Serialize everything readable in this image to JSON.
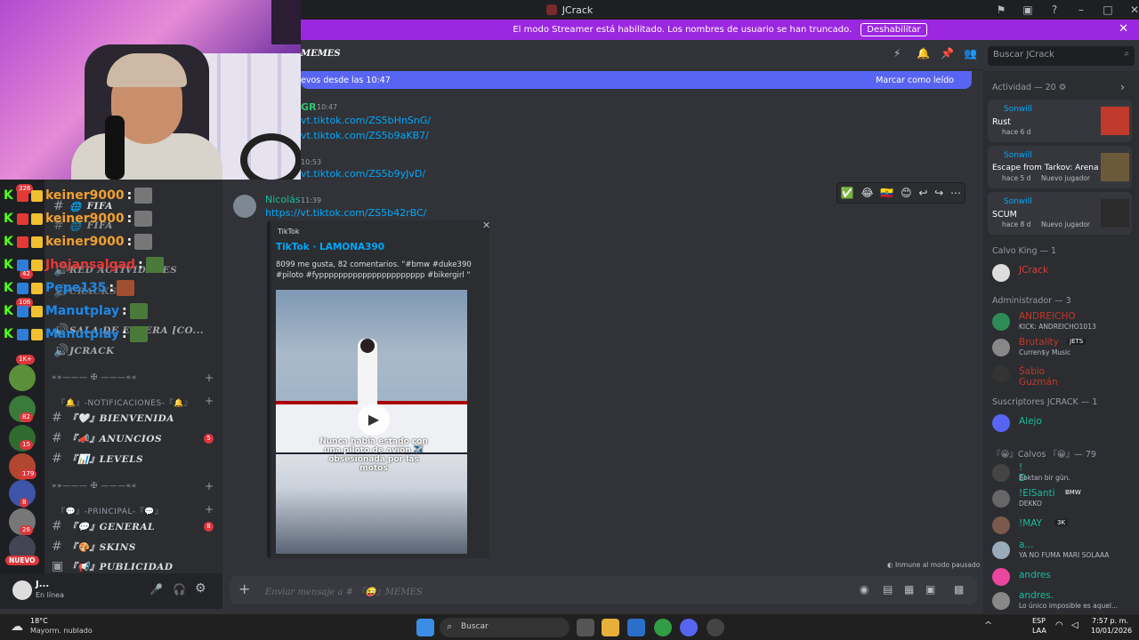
{
  "window": {
    "title": "JCrack",
    "brand_color": "#9c27e0"
  },
  "banner": {
    "text": "El modo Streamer está habilitado. Los nombres de usuario se han truncado.",
    "button": "Deshabilitar"
  },
  "channel_header": {
    "name": "MEMES"
  },
  "new_messages": {
    "text": "evos desde las 10:47",
    "mark_read": "Marcar como leído"
  },
  "messages": [
    {
      "author": "GR",
      "time": "10:47",
      "lines": [
        "vt.tiktok.com/ZS5bHnSnG/",
        "vt.tiktok.com/ZS5b9aKB7/"
      ]
    },
    {
      "time": "10:53",
      "lines": [
        "vt.tiktok.com/ZS5b9yJvD/"
      ]
    },
    {
      "author": "Nicolás",
      "time": "11:39",
      "link": "https://vt.tiktok.com/ZS5b42rBC/"
    }
  ],
  "embed": {
    "provider": "TikTok",
    "title": "TikTok · LAMONA390",
    "description": "8099 me gusta, 82 comentarios. \"#bmw #duke390 #piloto #fypppppppppppppppppppppp #bikergirl \"",
    "caption": "Nunca había estado con una piloto de avión ✈️ obsesionada por las motos"
  },
  "hover_icons": [
    "✅",
    "😂",
    "🇪🇨",
    "😊",
    "↩",
    "↪",
    "⋯"
  ],
  "footer_note": "Inmune al modo pausado",
  "input": {
    "placeholder": "Enviar mensaje a # 『😜』MEMES"
  },
  "search": {
    "placeholder": "Buscar JCrack"
  },
  "members": {
    "activity_header": "Actividad — 20 ⚙",
    "activities": [
      {
        "name": "Sonwill",
        "game": "Rust",
        "time": "hace 6 d",
        "extra": ""
      },
      {
        "name": "Sonwill",
        "game": "Escape from Tarkov: Arena",
        "time": "hace 5 d",
        "extra": "Nuevo jugador"
      },
      {
        "name": "Sonwill",
        "game": "SCUM",
        "time": "hace 8 d",
        "extra": "Nuevo jugador"
      }
    ],
    "groups": [
      {
        "header": "Calvo King — 1",
        "rows": [
          {
            "name": "JCrack",
            "sub": "",
            "color": "#e03e3e"
          }
        ]
      },
      {
        "header": "Administrador — 3",
        "rows": [
          {
            "name": "ANDREICHO",
            "sub": "KICK: ANDREICHO1013",
            "color": "#c0392b"
          },
          {
            "name": "Brutality",
            "sub": "Curren$y Music",
            "color": "#c0392b",
            "tag": "JETS"
          },
          {
            "name": "Šabio Guzmán",
            "sub": "",
            "color": "#c0392b"
          }
        ]
      },
      {
        "header": "Suscriptores JCRACK — 1",
        "rows": [
          {
            "name": "Alejo",
            "sub": "",
            "color": "#1abc9c"
          }
        ]
      },
      {
        "header": "『😀』Calvos 『😀』— 79",
        "rows": [
          {
            "name": "! D",
            "sub": "Boktan bir gün.",
            "color": "#1abc9c"
          },
          {
            "name": "!ElSanti",
            "sub": "DEKKO",
            "color": "#1abc9c",
            "tag": "BMW"
          },
          {
            "name": "!MAY",
            "sub": "",
            "color": "#1abc9c",
            "tag": "3K"
          },
          {
            "name": "a...",
            "sub": "YA NO FUMA MARI SOLAAA",
            "color": "#1abc9c"
          },
          {
            "name": "andres",
            "sub": "",
            "color": "#1abc9c"
          },
          {
            "name": "andres.",
            "sub": "Lo único imposible es aquel...",
            "color": "#1abc9c"
          }
        ]
      }
    ]
  },
  "chat_overlay": [
    {
      "user": "keiner9000",
      "color": "#f0a030"
    },
    {
      "user": "keiner9000",
      "color": "#f0a030"
    },
    {
      "user": "keiner9000",
      "color": "#f0a030"
    },
    {
      "user": "Jhojansalgad",
      "color": "#e53935"
    },
    {
      "user": "Pepe135",
      "color": "#1e88e5"
    },
    {
      "user": "Manutplay",
      "color": "#1e88e5"
    },
    {
      "user": "Manutplay",
      "color": "#1e88e5"
    }
  ],
  "channels": {
    "items": [
      {
        "label": "FIFA",
        "icon": "🌐"
      },
      {
        "label": "FIFA",
        "icon": "🌐"
      },
      {
        "label": "RED ACTIVIDADES",
        "icon": "🔊"
      },
      {
        "label": "CRACKS",
        "icon": "🔊"
      },
      {
        "label": "JCRACK",
        "icon": "🔊"
      }
    ],
    "cat_streams": "『🔔』-NOTIFICACIONES-『🔔』",
    "notif": [
      {
        "label": "『🤍』BIENVENIDA",
        "badge": ""
      },
      {
        "label": "『📣』ANUNCIOS",
        "badge": "5"
      },
      {
        "label": "『📊』LEVELS",
        "badge": ""
      }
    ],
    "cat_main": "『💬』-PRINCIPAL-『💬』",
    "main": [
      {
        "label": "『💬』GENERAL",
        "badge": "8"
      },
      {
        "label": "『🎨』SKINS",
        "badge": ""
      },
      {
        "label": "『📢』PUBLICIDAD",
        "badge": ""
      }
    ],
    "sala": "SALA DE ESPERA [CO..."
  },
  "user_panel": {
    "name": "J...",
    "status": "En línea"
  },
  "server_badges": [
    "326",
    "42",
    "106",
    "1K+",
    "82",
    "15",
    "179",
    "8",
    "26"
  ],
  "nuevo": "NUEVO",
  "taskbar": {
    "weather_temp": "18°C",
    "weather_desc": "Mayorm. nublado",
    "search": "Buscar",
    "lang1": "ESP",
    "lang2": "LAA",
    "time": "7:57 p. m.",
    "date": "10/01/2026"
  }
}
